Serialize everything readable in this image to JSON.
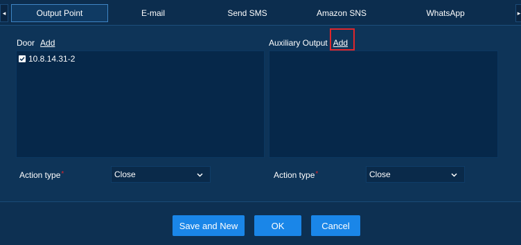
{
  "tabs": [
    {
      "label": "Output Point",
      "active": true
    },
    {
      "label": "E-mail",
      "active": false
    },
    {
      "label": "Send SMS",
      "active": false
    },
    {
      "label": "Amazon SNS",
      "active": false
    },
    {
      "label": "WhatsApp",
      "active": false
    }
  ],
  "tab_scroll": {
    "left_icon": "◂",
    "right_icon": "▸"
  },
  "door": {
    "label": "Door",
    "add_label": "Add",
    "items": [
      {
        "label": "10.8.14.31-2",
        "checked": true
      }
    ],
    "action_label": "Action type",
    "required_mark": "*",
    "action_value": "Close"
  },
  "auxiliary": {
    "label": "Auxiliary Output",
    "add_label": "Add",
    "items": [],
    "action_label": "Action type",
    "required_mark": "*",
    "action_value": "Close"
  },
  "footer": {
    "save_new_label": "Save and New",
    "ok_label": "OK",
    "cancel_label": "Cancel"
  },
  "colors": {
    "background": "#0e3458",
    "list_background": "#06284a",
    "button": "#1a86e8",
    "highlight": "#e0262b",
    "active_tab_border": "#3f86c6"
  }
}
